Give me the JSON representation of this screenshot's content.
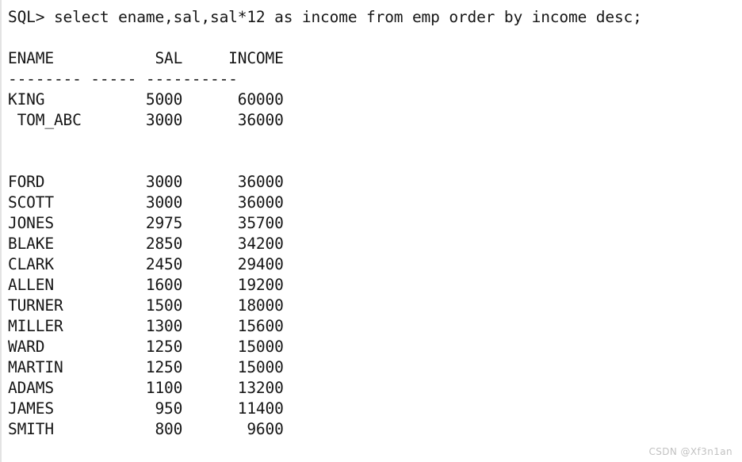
{
  "terminal": {
    "background_color": "#ffffff",
    "text_color": "#161616",
    "prompt": "SQL>",
    "command": "select ename,sal,sal*12 as income from emp order by income desc;",
    "prompt_line": "SQL> select ename,sal,sal*12 as income from emp order by income desc;"
  },
  "result_table": {
    "headers": [
      "ENAME",
      "SAL",
      "INCOME"
    ],
    "header_line": "ENAME           SAL     INCOME",
    "separator_line": "-------- ----- ----------",
    "separator_segments": [
      "--------",
      "-----",
      "----------"
    ],
    "column_alignment": [
      "left",
      "right",
      "right"
    ],
    "rows": [
      {
        "ename": "KING",
        "sal": "5000",
        "income": "60000",
        "indent": 0,
        "line": "KING           5000      60000"
      },
      {
        "ename": "TOM_ABC",
        "sal": "3000",
        "income": "36000",
        "indent": 1,
        "line": " TOM_ABC       3000      36000"
      },
      {
        "ename": "FORD",
        "sal": "3000",
        "income": "36000",
        "indent": 0,
        "line": "FORD           3000      36000"
      },
      {
        "ename": "SCOTT",
        "sal": "3000",
        "income": "36000",
        "indent": 0,
        "line": "SCOTT          3000      36000"
      },
      {
        "ename": "JONES",
        "sal": "2975",
        "income": "35700",
        "indent": 0,
        "line": "JONES          2975      35700"
      },
      {
        "ename": "BLAKE",
        "sal": "2850",
        "income": "34200",
        "indent": 0,
        "line": "BLAKE          2850      34200"
      },
      {
        "ename": "CLARK",
        "sal": "2450",
        "income": "29400",
        "indent": 0,
        "line": "CLARK          2450      29400"
      },
      {
        "ename": "ALLEN",
        "sal": "1600",
        "income": "19200",
        "indent": 0,
        "line": "ALLEN          1600      19200"
      },
      {
        "ename": "TURNER",
        "sal": "1500",
        "income": "18000",
        "indent": 0,
        "line": "TURNER         1500      18000"
      },
      {
        "ename": "MILLER",
        "sal": "1300",
        "income": "15600",
        "indent": 0,
        "line": "MILLER         1300      15600"
      },
      {
        "ename": "WARD",
        "sal": "1250",
        "income": "15000",
        "indent": 0,
        "line": "WARD           1250      15000"
      },
      {
        "ename": "MARTIN",
        "sal": "1250",
        "income": "15000",
        "indent": 0,
        "line": "MARTIN         1250      15000"
      },
      {
        "ename": "ADAMS",
        "sal": "1100",
        "income": "13200",
        "indent": 0,
        "line": "ADAMS          1100      13200"
      },
      {
        "ename": "JAMES",
        "sal": "950",
        "income": "11400",
        "indent": 0,
        "line": "JAMES           950      11400"
      },
      {
        "ename": "SMITH",
        "sal": "800",
        "income": "9600",
        "indent": 0,
        "line": "SMITH           800       9600"
      }
    ],
    "blank_rows_after_index": 1,
    "blank_rows_count": 2
  },
  "watermark": {
    "text": "CSDN @Xf3n1an",
    "color": "#c2c2c2"
  }
}
